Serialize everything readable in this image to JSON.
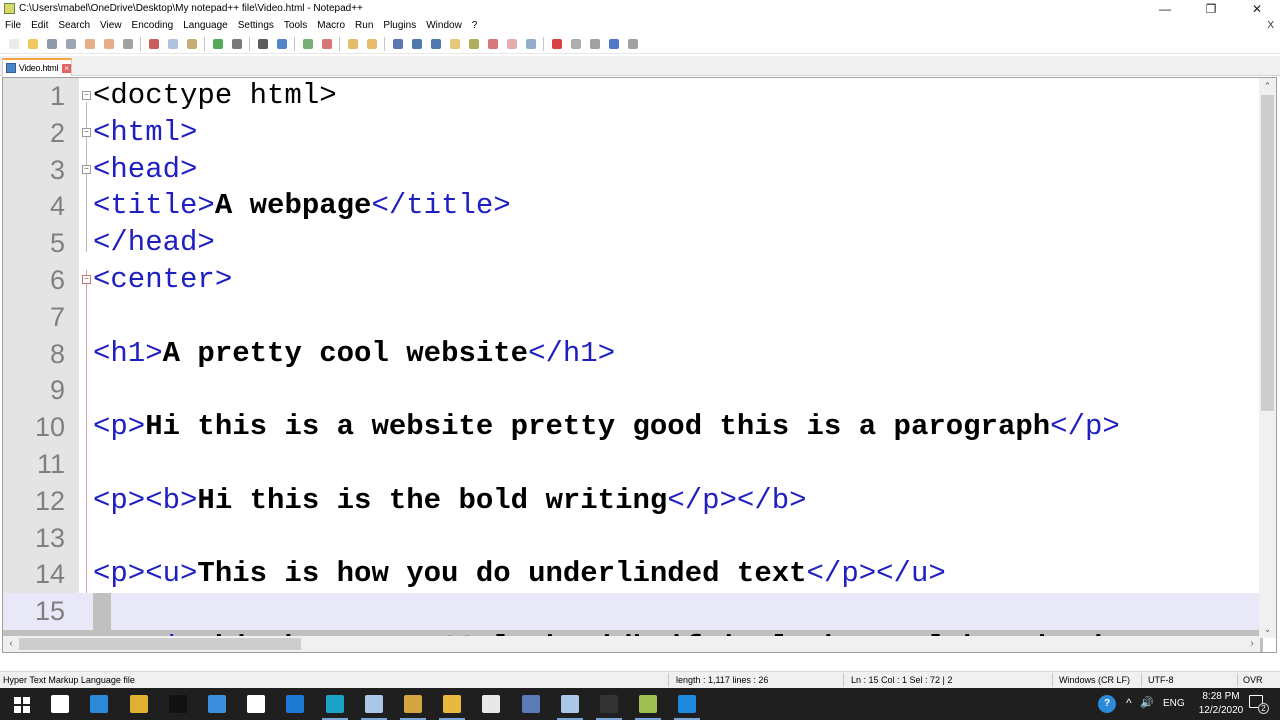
{
  "window": {
    "title": "C:\\Users\\mabel\\OneDrive\\Desktop\\My notepad++ file\\Video.html - Notepad++",
    "controls": {
      "minimize": "—",
      "restore": "❐",
      "close": "✕"
    }
  },
  "menubar": {
    "items": [
      "File",
      "Edit",
      "Search",
      "View",
      "Encoding",
      "Language",
      "Settings",
      "Tools",
      "Macro",
      "Run",
      "Plugins",
      "Window",
      "?"
    ],
    "close_doc": "X"
  },
  "toolbar": {
    "groups": [
      [
        "new-file-icon",
        "open-file-icon",
        "save-icon",
        "save-all-icon",
        "close-icon",
        "close-all-icon",
        "print-icon"
      ],
      [
        "cut-icon",
        "copy-icon",
        "paste-icon"
      ],
      [
        "undo-icon",
        "redo-icon"
      ],
      [
        "find-icon",
        "replace-icon"
      ],
      [
        "zoom-in-icon",
        "zoom-out-icon"
      ],
      [
        "sync-vertical-icon",
        "sync-horizontal-icon"
      ],
      [
        "word-wrap-icon",
        "show-all-characters-icon",
        "indent-guide-icon",
        "document-map-icon",
        "function-list-icon",
        "folder-workspace-icon",
        "folder-icon",
        "monitoring-icon"
      ],
      [
        "record-macro-icon",
        "stop-macro-icon",
        "play-macro-icon",
        "run-macro-multiple-icon",
        "save-macro-icon"
      ]
    ]
  },
  "tabs": [
    {
      "label": "Video.html",
      "active": true
    }
  ],
  "editor": {
    "lines": [
      {
        "n": "1",
        "fold": "minus",
        "parts": [
          {
            "t": "plain",
            "v": "<doctype html>"
          }
        ]
      },
      {
        "n": "2",
        "fold": "minus",
        "parts": [
          {
            "t": "tag",
            "v": "<html>"
          }
        ]
      },
      {
        "n": "3",
        "fold": "minus",
        "parts": [
          {
            "t": "tag",
            "v": "<head>"
          }
        ]
      },
      {
        "n": "4",
        "fold": "",
        "parts": [
          {
            "t": "tag",
            "v": "<title>"
          },
          {
            "t": "txt",
            "v": "A webpage"
          },
          {
            "t": "tag",
            "v": "</title>"
          }
        ]
      },
      {
        "n": "5",
        "fold": "",
        "parts": [
          {
            "t": "tag",
            "v": "</head>"
          }
        ]
      },
      {
        "n": "6",
        "fold": "minus-red",
        "parts": [
          {
            "t": "tag",
            "v": "<center>"
          }
        ]
      },
      {
        "n": "7",
        "fold": "",
        "parts": []
      },
      {
        "n": "8",
        "fold": "",
        "parts": [
          {
            "t": "tag",
            "v": "<h1>"
          },
          {
            "t": "txt",
            "v": "A pretty cool website"
          },
          {
            "t": "tag",
            "v": "</h1>"
          }
        ]
      },
      {
        "n": "9",
        "fold": "",
        "parts": []
      },
      {
        "n": "10",
        "fold": "",
        "parts": [
          {
            "t": "tag",
            "v": "<p>"
          },
          {
            "t": "txt",
            "v": "Hi this is a website pretty good this is a parograph"
          },
          {
            "t": "tag",
            "v": "</p>"
          }
        ]
      },
      {
        "n": "11",
        "fold": "",
        "parts": []
      },
      {
        "n": "12",
        "fold": "",
        "parts": [
          {
            "t": "tag",
            "v": "<p><b>"
          },
          {
            "t": "txt",
            "v": "Hi this is the bold writing"
          },
          {
            "t": "tag",
            "v": "</p></b>"
          }
        ]
      },
      {
        "n": "13",
        "fold": "",
        "parts": []
      },
      {
        "n": "14",
        "fold": "",
        "parts": [
          {
            "t": "tag",
            "v": "<p><u>"
          },
          {
            "t": "txt",
            "v": "This is how you do underlinded text"
          },
          {
            "t": "tag",
            "v": "</p></u>"
          }
        ]
      },
      {
        "n": "15",
        "fold": "",
        "current": true,
        "parts": []
      },
      {
        "n": "16",
        "fold": "",
        "selected": true,
        "parts": [
          {
            "t": "tag",
            "v": "<p><i>"
          },
          {
            "t": "txt",
            "v": "This how ITALICS looks idk if it looks cool but it does"
          }
        ]
      }
    ],
    "vscroll": {
      "visible_fraction": 0.6,
      "position_fraction": 0.0
    },
    "hscroll": {
      "visible_fraction": 0.23,
      "position_fraction": 0.0
    },
    "scroll_arrows": {
      "up": "⌃",
      "down": "⌄",
      "left": "‹",
      "right": "›"
    }
  },
  "statusbar": {
    "file_type": "Hyper Text Markup Language file",
    "length": "length : 1,117    lines : 26",
    "position": "Ln : 15    Col : 1    Sel : 72 | 2",
    "eol": "Windows (CR LF)",
    "encoding": "UTF-8",
    "mode": "OVR"
  },
  "taskbar": {
    "apps": [
      {
        "name": "start-button",
        "color": "#ffffff"
      },
      {
        "name": "amazon-app",
        "color": "#ffffff"
      },
      {
        "name": "mail-app",
        "color": "#2a8ad8"
      },
      {
        "name": "chrome-app",
        "color": "#e0b030"
      },
      {
        "name": "netflix-app",
        "color": "#111111"
      },
      {
        "name": "vs-app",
        "color": "#3a8fe0"
      },
      {
        "name": "dropbox-app",
        "color": "#ffffff"
      },
      {
        "name": "remote-app",
        "color": "#1c7ad4"
      },
      {
        "name": "edge-app",
        "color": "#1aa4c8"
      },
      {
        "name": "notes-app",
        "color": "#a9c8e8"
      },
      {
        "name": "chrome-profile-app",
        "color": "#d6a440"
      },
      {
        "name": "file-explorer-app",
        "color": "#e8b840"
      },
      {
        "name": "store-app",
        "color": "#e8e8e8"
      },
      {
        "name": "calculator-app",
        "color": "#5a7ab8"
      },
      {
        "name": "notes2-app",
        "color": "#a9c8e8"
      },
      {
        "name": "obs-app",
        "color": "#333333"
      },
      {
        "name": "notepadpp-app",
        "color": "#9ec050"
      },
      {
        "name": "media-app",
        "color": "#1c8ae0"
      }
    ],
    "tray": {
      "language": "ENG",
      "time": "8:28 PM",
      "date": "12/2/2020",
      "notifications": "2",
      "chevron": "^",
      "volume": "🔊"
    }
  }
}
